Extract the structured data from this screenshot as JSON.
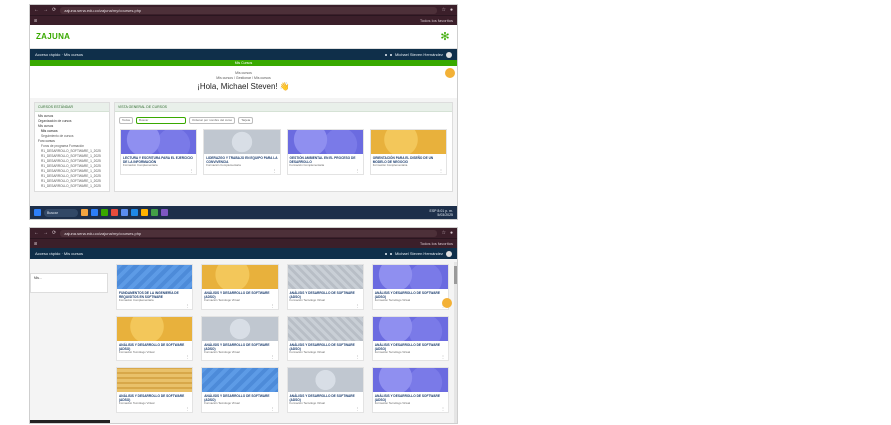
{
  "browser": {
    "address_top": "zajuna.sena.edu.co/zajuna/my/courses.php",
    "address_bottom": "zajuna.sena.edu.co/zajuna/my/courses.php",
    "tab_right_top": "Todos los favoritos",
    "tab_right_bottom": "Todos los favoritos"
  },
  "app": {
    "logo": "ZAJUNA",
    "nav_left": "Acceso rápido · Mis cursos",
    "user_name": "Michael Steven Hernández",
    "banner": "Mis Cursos",
    "breadcrumb_1": "Mis cursos",
    "breadcrumb_2": "Mis cursos / Gestionar / Mis cursos",
    "greeting": "¡Hola, Michael Steven!",
    "greeting_emoji": "👋"
  },
  "sidebar": {
    "header": "CURSOS ESTÁNDAR",
    "items": [
      {
        "label": "Mis cursos",
        "level": 0
      },
      {
        "label": "Organización de cursos",
        "level": 0
      },
      {
        "label": "Mis cursos",
        "level": 0
      },
      {
        "label": "Mis cursos",
        "level": 1,
        "bold": true
      },
      {
        "label": "Seguimiento de cursos",
        "level": 1
      },
      {
        "label": "Foro cursos",
        "level": 0
      },
      {
        "label": "Foros de programa Formación",
        "level": 1
      },
      {
        "label": "R1_DESARROLLO_SOFTWARE_1_2025",
        "level": 1
      },
      {
        "label": "R1_DESARROLLO_SOFTWARE_1_2025",
        "level": 1
      },
      {
        "label": "R1_DESARROLLO_SOFTWARE_1_2025",
        "level": 1
      },
      {
        "label": "R1_DESARROLLO_SOFTWARE_1_2025",
        "level": 1
      },
      {
        "label": "R1_DESARROLLO_SOFTWARE_1_2025",
        "level": 1
      },
      {
        "label": "R1_DESARROLLO_SOFTWARE_1_2025",
        "level": 1
      },
      {
        "label": "R1_DESARROLLO_SOFTWARE_1_2025",
        "level": 1
      },
      {
        "label": "R1_DESARROLLO_SOFTWARE_1_2025",
        "level": 1
      }
    ],
    "partial_bottom": "Mis..."
  },
  "main": {
    "header": "VISTA GENERAL DE CURSOS",
    "filters": {
      "all": "Todos",
      "search_placeholder": "Buscar",
      "sort": "Ordenar por nombre del curso",
      "view": "Tarjeta"
    },
    "cards_top": [
      {
        "title": "LECTURA Y ESCRITURA PARA EL EJERCICIO DE LA INFORMACIÓN",
        "sub": "Formación Complementaria",
        "pattern": "purple"
      },
      {
        "title": "LIDERAZGO Y TRABAJO EN EQUIPO PARA LA CONVIVENCIA",
        "sub": "Formación Complementaria",
        "pattern": "silver"
      },
      {
        "title": "GESTIÓN AMBIENTAL EN EL PROCESO DE DESARROLLO",
        "sub": "Formación Complementaria",
        "pattern": "purple"
      },
      {
        "title": "ORIENTACIÓN PARA EL DISEÑO DE UN MODELO DE NEGOCIO",
        "sub": "Formación Complementaria",
        "pattern": "gold"
      }
    ],
    "cards_bottom": [
      {
        "title": "FUNDAMENTOS DE LA INGENIERÍA DE REQUISITOS EN SOFTWARE",
        "sub": "Formación Complementaria",
        "pattern": "blue"
      },
      {
        "title": "ANÁLISIS Y DESARROLLO DE SOFTWARE (ADSO)",
        "sub": "Formación Tecnólogo Virtual",
        "pattern": "gold"
      },
      {
        "title": "ANÁLISIS Y DESARROLLO DE SOFTWARE (ADSO)",
        "sub": "Formación Tecnólogo Virtual",
        "pattern": "grey"
      },
      {
        "title": "ANÁLISIS Y DESARROLLO DE SOFTWARE (ADSO)",
        "sub": "Formación Tecnólogo Virtual",
        "pattern": "purple"
      },
      {
        "title": "ANÁLISIS Y DESARROLLO DE SOFTWARE (ADSO)",
        "sub": "Formación Tecnólogo Virtual",
        "pattern": "gold"
      },
      {
        "title": "ANÁLISIS Y DESARROLLO DE SOFTWARE (ADSO)",
        "sub": "Formación Tecnólogo Virtual",
        "pattern": "silver"
      },
      {
        "title": "ANÁLISIS Y DESARROLLO DE SOFTWARE (ADSO)",
        "sub": "Formación Tecnólogo Virtual",
        "pattern": "grey"
      },
      {
        "title": "ANÁLISIS Y DESARROLLO DE SOFTWARE (ADSO)",
        "sub": "Formación Tecnólogo Virtual",
        "pattern": "purple"
      },
      {
        "title": "ANÁLISIS Y DESARROLLO DE SOFTWARE (ADSO)",
        "sub": "Formación Tecnólogo Virtual",
        "pattern": "plaid"
      },
      {
        "title": "ANÁLISIS Y DESARROLLO DE SOFTWARE (ADSO)",
        "sub": "Formación Tecnólogo Virtual",
        "pattern": "blue"
      },
      {
        "title": "ANÁLISIS Y DESARROLLO DE SOFTWARE (ADSO)",
        "sub": "Formación Tecnólogo Virtual",
        "pattern": "silver"
      },
      {
        "title": "ANÁLISIS Y DESARROLLO DE SOFTWARE (ADSO)",
        "sub": "Formación Tecnólogo Virtual",
        "pattern": "purple"
      }
    ],
    "card_menu": "⋮"
  },
  "taskbar": {
    "search": "Buscar",
    "lang": "ESP",
    "time": "8:01 p. m.",
    "date": "5/03/2025",
    "icon_colors": [
      "#f2a541",
      "#2d7ff9",
      "#39a900",
      "#e74c3c",
      "#5b8def",
      "#1e88e5",
      "#ffb300",
      "#43a047",
      "#7e57c2"
    ]
  },
  "colors": {
    "sena_green": "#39a900",
    "navbar": "#0f2f4a",
    "browser_chrome": "#3b1f2a",
    "accent_orange": "#f3b136"
  }
}
